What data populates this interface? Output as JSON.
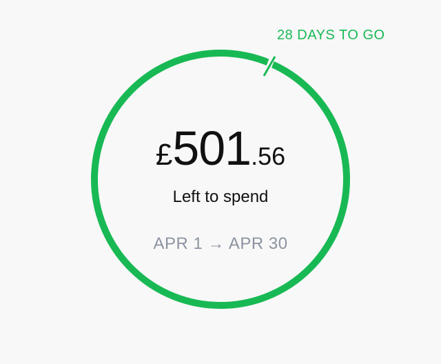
{
  "budget": {
    "days_remaining_label": "28 DAYS TO GO",
    "currency_symbol": "£",
    "amount_major": "501",
    "amount_minor": ".56",
    "caption": "Left to spend",
    "period": {
      "start": "APR 1",
      "arrow": "→",
      "end": "APR 30"
    },
    "ring_color": "#18b954",
    "days_label_color": "#18b954",
    "period_color": "#8c93a0"
  }
}
